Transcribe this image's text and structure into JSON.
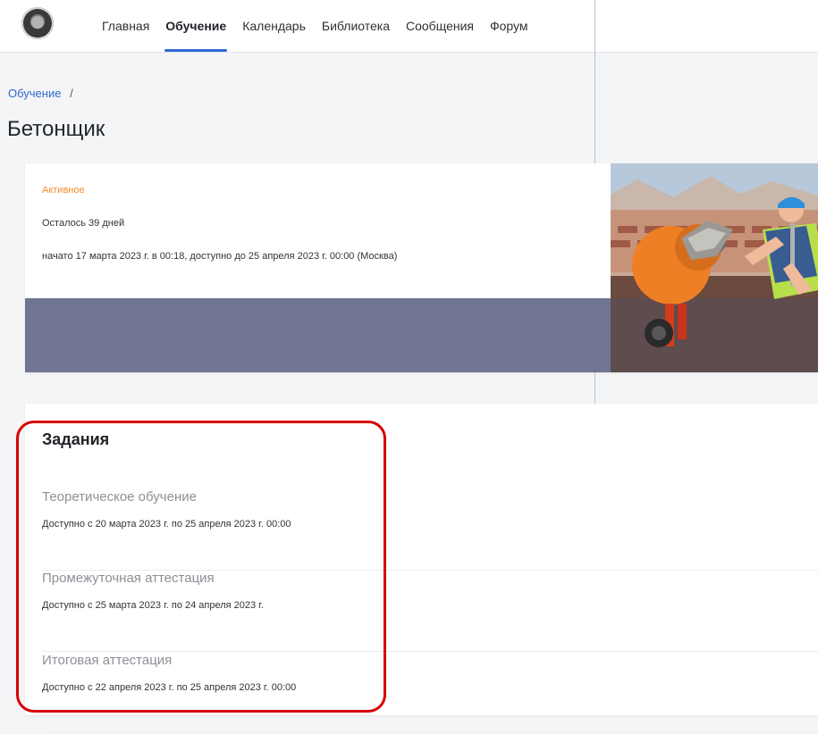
{
  "header": {
    "nav": [
      {
        "label": "Главная",
        "active": false
      },
      {
        "label": "Обучение",
        "active": true
      },
      {
        "label": "Календарь",
        "active": false
      },
      {
        "label": "Библиотека",
        "active": false
      },
      {
        "label": "Сообщения",
        "active": false
      },
      {
        "label": "Форум",
        "active": false
      }
    ]
  },
  "breadcrumb": {
    "link": "Обучение",
    "separator": "/"
  },
  "page": {
    "title": "Бетонщик"
  },
  "course": {
    "status": "Активное",
    "remaining": "Осталось 39 дней",
    "dates": "начато 17 марта 2023 г. в 00:18, доступно до 25 апреля 2023 г. 00:00 (Москва)"
  },
  "tasks": {
    "title": "Задания",
    "items": [
      {
        "name": "Теоретическое обучение",
        "date": "Доступно с 20 марта 2023 г. по 25 апреля 2023 г. 00:00"
      },
      {
        "name": "Промежуточная аттестация",
        "date": "Доступно с 25 марта 2023 г. по 24 апреля 2023 г."
      },
      {
        "name": "Итоговая аттестация",
        "date": "Доступно с 22 апреля 2023 г. по 25 апреля 2023 г. 00:00"
      }
    ]
  },
  "colors": {
    "accent": "#2f68d1",
    "status": "#f08c2a",
    "course_band": "#6f7592",
    "highlight": "#d80000"
  },
  "icons": [
    "logo-emblem"
  ]
}
